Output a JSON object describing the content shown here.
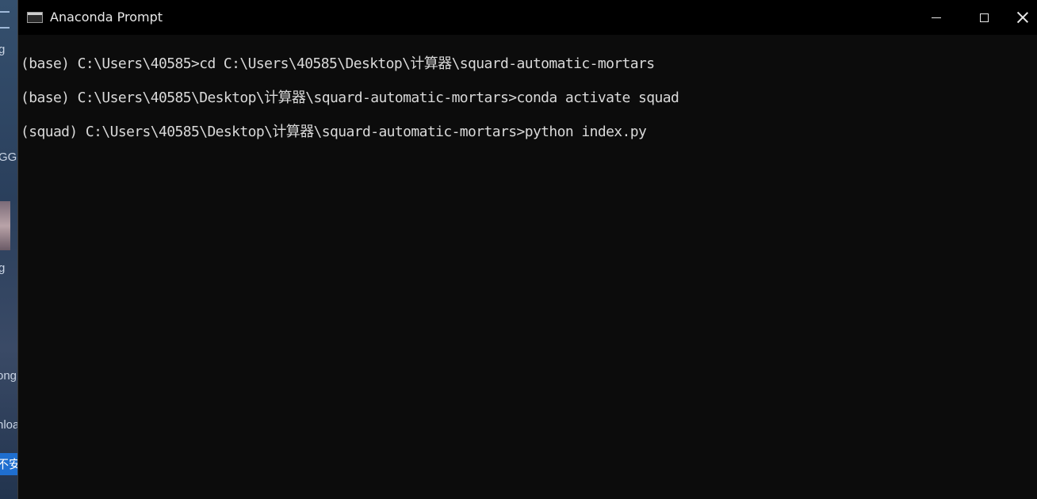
{
  "window": {
    "title": "Anaconda Prompt",
    "icon": "console-icon"
  },
  "controls": {
    "minimize": "minimize-icon",
    "maximize": "maximize-icon",
    "close": "close-icon"
  },
  "console": {
    "lines": [
      "(base) C:\\Users\\40585>cd C:\\Users\\40585\\Desktop\\计算器\\squard-automatic-mortars",
      "(base) C:\\Users\\40585\\Desktop\\计算器\\squard-automatic-mortars>conda activate squad",
      "(squad) C:\\Users\\40585\\Desktop\\计算器\\squard-automatic-mortars>python index.py"
    ]
  },
  "desktop_peek": {
    "items": [
      "g",
      "GG",
      "g",
      "ong",
      "nloa",
      "不安"
    ]
  }
}
